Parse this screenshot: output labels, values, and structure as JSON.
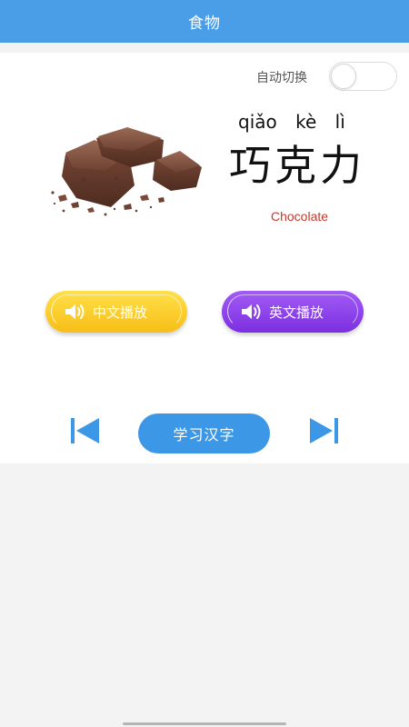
{
  "header": {
    "title": "食物"
  },
  "auto_switch": {
    "label": "自动切换",
    "enabled": false
  },
  "word": {
    "image_icon": "chocolate-image",
    "pinyin": "qiǎo kè lì",
    "hanzi": "巧克力",
    "english": "Chocolate"
  },
  "actions": {
    "chinese_play_label": "中文播放",
    "english_play_label": "英文播放",
    "learn_label": "学习汉字"
  },
  "navigation": {
    "prev_icon": "skip-previous-icon",
    "next_icon": "skip-next-icon"
  },
  "colors": {
    "header_bg": "#4a9ee8",
    "english_text": "#c8392b",
    "chinese_button": "#f9c620",
    "english_button": "#8a3ee8",
    "learn_button": "#3c97e6",
    "nav_icons": "#3c97e6"
  }
}
